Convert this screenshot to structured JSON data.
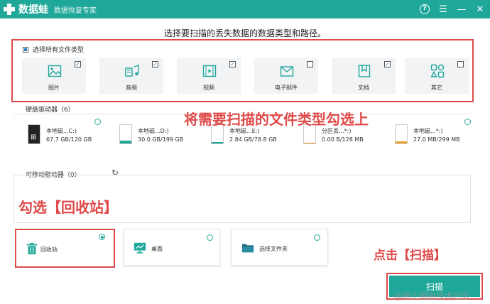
{
  "titlebar": {
    "app_name": "数据蛙",
    "subtitle": "数据恢复专家"
  },
  "headline": "选择要扫描的丢失数据的数据类型和路径。",
  "file_types": {
    "select_all_label": "选择所有文件类型",
    "items": [
      {
        "label": "图片",
        "icon": "image-icon",
        "checked": true
      },
      {
        "label": "音频",
        "icon": "music-icon",
        "checked": true
      },
      {
        "label": "视频",
        "icon": "video-icon",
        "checked": true
      },
      {
        "label": "电子邮件",
        "icon": "email-icon",
        "checked": false
      },
      {
        "label": "文档",
        "icon": "document-icon",
        "checked": true
      },
      {
        "label": "其它",
        "icon": "other-icon",
        "checked": false
      }
    ]
  },
  "hdd": {
    "title": "硬盘驱动器（6）",
    "drives": [
      {
        "name": "本地磁...C:)",
        "size": "67.7 GB/120 GB"
      },
      {
        "name": "本地磁...D:)",
        "size": "30.0 GB/199 GB"
      },
      {
        "name": "本地磁...E:)",
        "size": "2.84 GB/78.8 GB"
      },
      {
        "name": "分区丢...*:)",
        "size": "0.00  B/128 MB"
      },
      {
        "name": "本地磁...*:)",
        "size": "27.0 MB/299 MB"
      }
    ]
  },
  "removable": {
    "title": "可移动驱动器（0）"
  },
  "locations": [
    {
      "label": "回收站",
      "selected": true
    },
    {
      "label": "桌面",
      "selected": false
    },
    {
      "label": "选择文件夹",
      "selected": false
    }
  ],
  "scan_button": "扫描",
  "annotations": {
    "types": "将需要扫描的文件类型勾选上",
    "recycle": "勾选【回收站】",
    "scan": "点击【扫描】"
  },
  "watermark": "@稀土掘金技术社区",
  "colors": {
    "accent": "#1fa89a",
    "annotation": "#e04a4a"
  }
}
